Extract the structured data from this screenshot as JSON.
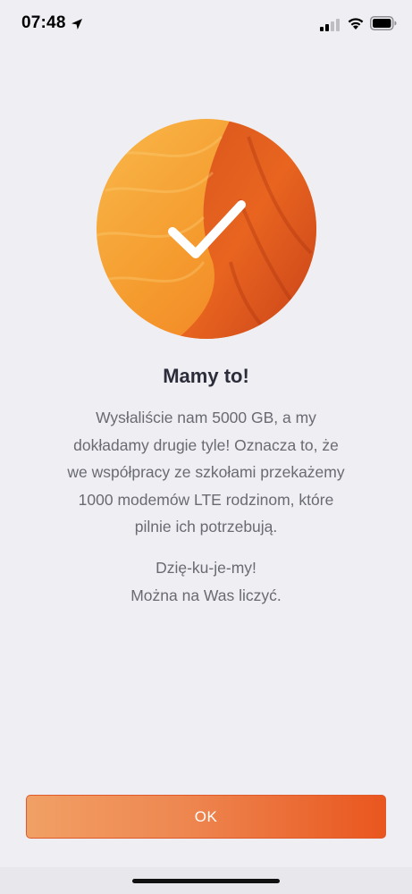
{
  "status_bar": {
    "time": "07:48",
    "icons": [
      "location-arrow-icon",
      "cellular-signal-icon",
      "wifi-icon",
      "battery-icon"
    ]
  },
  "hero": {
    "icon": "checkmark-icon",
    "colors": {
      "light": "#F7A53A",
      "mid": "#F07A22",
      "dark": "#C9421A",
      "check": "#FFFFFF"
    }
  },
  "content": {
    "title": "Mamy to!",
    "body_lines": [
      "Wysłaliście nam 5000 GB, a my",
      "dokładamy drugie tyle! Oznacza to, że",
      "we współpracy ze szkołami przekażemy",
      "1000 modemów LTE rodzinom, które",
      "pilnie ich potrzebują."
    ],
    "thanks_lines": [
      "Dzię-ku-je-my!",
      "Można na Was liczyć."
    ]
  },
  "actions": {
    "ok_label": "OK"
  },
  "colors": {
    "background": "#EFEEF3",
    "accent": "#E9561E",
    "title": "#2C2D3A",
    "text": "#6A6A72"
  }
}
